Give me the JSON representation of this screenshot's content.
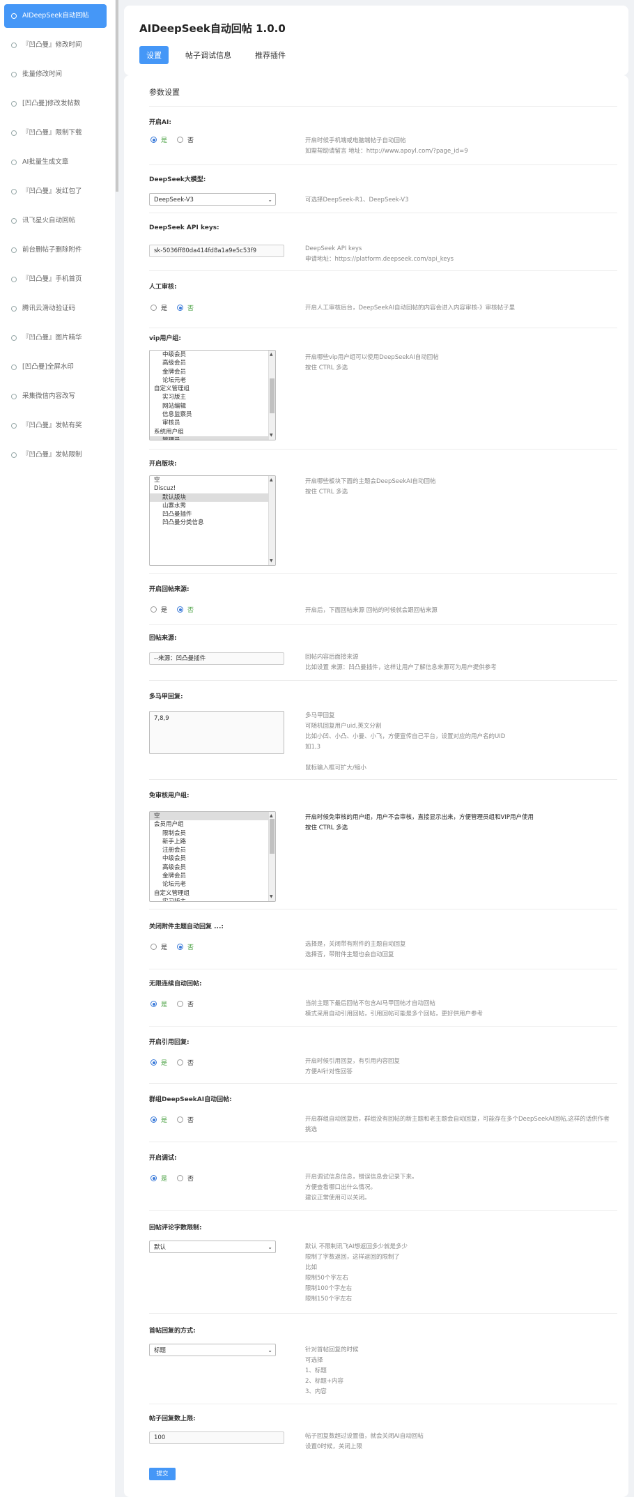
{
  "sidebar": {
    "items": [
      {
        "label": "AIDeepSeek自动回帖",
        "active": true
      },
      {
        "label": "『凹凸曼』修改时间"
      },
      {
        "label": "批量修改时间"
      },
      {
        "label": "[凹凸曼]修改发帖数"
      },
      {
        "label": "『凹凸曼』限制下载"
      },
      {
        "label": "AI批量生成文章"
      },
      {
        "label": "『凹凸曼』发红包了"
      },
      {
        "label": "讯飞星火自动回帖"
      },
      {
        "label": "前台删帖子删除附件"
      },
      {
        "label": "『凹凸曼』手机首页"
      },
      {
        "label": "腾讯云滑动验证码"
      },
      {
        "label": "『凹凸曼』图片精华"
      },
      {
        "label": "[凹凸曼]全屏水印"
      },
      {
        "label": "采集微信内容改写"
      },
      {
        "label": "『凹凸曼』发帖有奖"
      },
      {
        "label": "『凹凸曼』发帖限制"
      }
    ]
  },
  "header": {
    "title": "AIDeepSeek自动回帖 1.0.0",
    "tabs": [
      "设置",
      "帖子调试信息",
      "推荐插件"
    ]
  },
  "main": {
    "section_title": "参数设置",
    "radio_yes": "是",
    "radio_no": "否",
    "enable_ai": {
      "label": "开启AI:",
      "value": "是",
      "tip1": "开启时候手机端或电脑端帖子自动回帖",
      "tip2": "如需帮助请留言 地址：http://www.apoyl.com/?page_id=9"
    },
    "model": {
      "label": "DeepSeek大模型:",
      "value": "DeepSeek-V3",
      "tip1": "可选择DeepSeek-R1、DeepSeek-V3"
    },
    "api_key": {
      "label": "DeepSeek API keys:",
      "value": "sk-5036ff80da414fd8a1a9e5c53f9",
      "tip1": "DeepSeek API keys",
      "tip2": "申请地址：https://platform.deepseek.com/api_keys"
    },
    "manual_review": {
      "label": "人工审核:",
      "value": "否",
      "tip1": "开启人工审核后台，DeepSeekAI自动回帖的内容会进入内容审核-》审核帖子里"
    },
    "vip_groups": {
      "label": "vip用户组:",
      "options": [
        "中级会员",
        "高级会员",
        "金牌会员",
        "论坛元老",
        "自定义管理组",
        "实习版主",
        "网站编辑",
        "信息监察员",
        "审核员",
        "系统用户组",
        "管理员"
      ],
      "tip1": "开启哪些vip用户组可以使用DeepSeekAI自动回帖",
      "tip2": "按住 CTRL 多选"
    },
    "forums": {
      "label": "开启版块:",
      "options": [
        "空",
        "Discuz!",
        "默认版块",
        "山寨水秀",
        "凹凸曼插件",
        "凹凸曼分类信息"
      ],
      "tip1": "开启哪些板块下面的主题会DeepSeekAI自动回帖",
      "tip2": "按住 CTRL 多选"
    },
    "reply_source_enable": {
      "label": "开启回帖来源:",
      "value": "否",
      "tip1": "开启后，下面回帖来源 回帖的时候就会跟回帖来源"
    },
    "reply_source": {
      "label": "回帖来源:",
      "value": "--来源：凹凸曼插件",
      "tip1": "回帖内容后面接来源",
      "tip2": "比如设置 来源：凹凸曼插件，这样让用户了解信息来源可为用户提供参考"
    },
    "multi_reply": {
      "label": "多马甲回复:",
      "value": "7,8,9",
      "tips": [
        "多马甲回复",
        "可随机回复用户uid,英文分割",
        "比如小凹、小凸、小曼、小飞，方便宣传自己平台，设置对应的用户名的UID",
        "如1,3",
        "",
        "鼠标输入框可扩大/缩小"
      ]
    },
    "exempt_groups": {
      "label": "免审核用户组:",
      "options": [
        "空",
        "会员用户组",
        "限制会员",
        "新手上路",
        "注册会员",
        "中级会员",
        "高级会员",
        "金牌会员",
        "论坛元老",
        "自定义管理组",
        "实习版主"
      ],
      "tip1": "开启时候免审核的用户组，用户不会审核，直接显示出来，方便管理员组和VIP用户使用",
      "tip2": "按住 CTRL 多选"
    },
    "attach_close": {
      "label": "关闭附件主题自动回复 ...:",
      "value": "否",
      "tip1": "选择是，关闭带有附件的主题自动回复",
      "tip2": "选择否，带附件主题也会自动回复"
    },
    "unlimited": {
      "label": "无限连续自动回帖:",
      "value": "是",
      "tip1": "当前主题下最后回帖不包含AI马甲回帖才自动回帖",
      "tip2": "模式采用自动引用回帖，引用回帖可能是多个回帖，更好供用户参考"
    },
    "quote": {
      "label": "开启引用回复:",
      "value": "是",
      "tip1": "开启时候引用回复，有引用内容回复",
      "tip2": "方便AI针对性回答"
    },
    "group": {
      "label": "群组DeepSeekAI自动回帖:",
      "value": "是",
      "tip1": "开启群组自动回复后，群组没有回帖的新主题和老主题会自动回复，可能存在多个DeepSeekAI回帖,这样的话供作者",
      "tip2": "挑选"
    },
    "debug": {
      "label": "开启调试:",
      "value": "是",
      "tip1": "开启调试信息信息，错误信息会记录下来。",
      "tip2": "方便查看哪口出什么情况。",
      "tip3": "建议正常使用可以关闭。"
    },
    "word_limit": {
      "label": "回帖评论字数限制:",
      "value": "默认",
      "tips": [
        "默认 不限制讯飞AI想返回多少就是多少",
        "限制了字数返回，这样返回的限制了",
        "比如",
        "限制50个字左右",
        "限制100个字左右",
        "限制150个字左右"
      ]
    },
    "first_reply": {
      "label": "首帖回复的方式:",
      "value": "标题",
      "tips": [
        "针对首帖回复的时候",
        "可选择",
        "1、标题",
        "2、标题+内容",
        "3、内容"
      ]
    },
    "max_replies": {
      "label": "帖子回复数上限:",
      "value": "100",
      "tip1": "帖子回复数超过设置值，就会关闭AI自动回帖",
      "tip2": "设置0时候，关闭上限"
    },
    "submit": "提交"
  }
}
